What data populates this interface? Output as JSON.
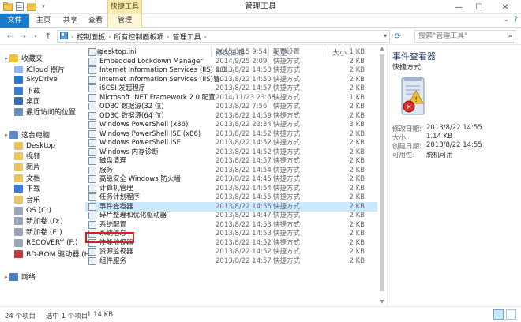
{
  "window": {
    "title": "管理工具",
    "context_tab_label": "快捷工具",
    "buttons": [
      "—",
      "☐",
      "✕"
    ]
  },
  "ribbon": {
    "tabs": [
      "文件",
      "主页",
      "共享",
      "查看",
      "管理"
    ],
    "right_icons": [
      "⌄",
      "?"
    ]
  },
  "address": {
    "path": [
      "控制面板",
      "所有控制面板项",
      "管理工具"
    ],
    "search_placeholder": "搜索\"管理工具\""
  },
  "nav": {
    "items": [
      {
        "label": "收藏夹",
        "level": 0,
        "icon": "star-icon",
        "color": "#f2c12e"
      },
      {
        "label": "iCloud 照片",
        "level": 1,
        "icon": "cloud-icon",
        "color": "#8fb8e8"
      },
      {
        "label": "SkyDrive",
        "level": 1,
        "icon": "skydrive-icon",
        "color": "#2a79c9"
      },
      {
        "label": "下载",
        "level": 1,
        "icon": "download-folder-icon",
        "color": "#3a7bd5"
      },
      {
        "label": "桌面",
        "level": 1,
        "icon": "desktop-folder-icon",
        "color": "#3f6fb3"
      },
      {
        "label": "最近访问的位置",
        "level": 1,
        "icon": "recent-places-icon",
        "color": "#6b8fbd"
      },
      {
        "label": "这台电脑",
        "level": 0,
        "icon": "computer-icon",
        "color": "#5d8ac7"
      },
      {
        "label": "Desktop",
        "level": 1,
        "icon": "folder-icon",
        "color": "#e8c462"
      },
      {
        "label": "视频",
        "level": 1,
        "icon": "videos-folder-icon",
        "color": "#e8c462"
      },
      {
        "label": "图片",
        "level": 1,
        "icon": "pictures-folder-icon",
        "color": "#e8c462"
      },
      {
        "label": "文档",
        "level": 1,
        "icon": "documents-folder-icon",
        "color": "#e8c462"
      },
      {
        "label": "下载",
        "level": 1,
        "icon": "downloads-folder-icon",
        "color": "#3a7bd5"
      },
      {
        "label": "音乐",
        "level": 1,
        "icon": "music-folder-icon",
        "color": "#e8c462"
      },
      {
        "label": "OS (C:)",
        "level": 1,
        "icon": "drive-c-icon",
        "color": "#9aa6b4"
      },
      {
        "label": "新加卷 (D:)",
        "level": 1,
        "icon": "drive-icon",
        "color": "#9aa6b4"
      },
      {
        "label": "新加卷 (E:)",
        "level": 1,
        "icon": "drive-icon",
        "color": "#9aa6b4"
      },
      {
        "label": "RECOVERY (F:)",
        "level": 1,
        "icon": "drive-icon",
        "color": "#9aa6b4"
      },
      {
        "label": "BD-ROM 驱动器 (H",
        "level": 1,
        "icon": "bd-rom-icon",
        "color": "#c43b3b"
      },
      {
        "label": "网络",
        "level": 0,
        "icon": "network-icon",
        "color": "#4a7fc1"
      }
    ]
  },
  "columns": {
    "name": "名称",
    "date": "修改日期",
    "type": "类型",
    "size": "大小"
  },
  "files": [
    {
      "name": "desktop.ini",
      "date": "2015/3/15 9:54",
      "type": "配置设置",
      "size": "1 KB"
    },
    {
      "name": "Embedded Lockdown Manager",
      "date": "2014/9/25 2:09",
      "type": "快捷方式",
      "size": "2 KB"
    },
    {
      "name": "Internet Information Services (IIS) 6.0...",
      "date": "2013/8/22 14:50",
      "type": "快捷方式",
      "size": "2 KB"
    },
    {
      "name": "Internet Information Services (IIS)管...",
      "date": "2013/8/22 14:50",
      "type": "快捷方式",
      "size": "2 KB"
    },
    {
      "name": "iSCSI 发起程序",
      "date": "2013/8/22 14:57",
      "type": "快捷方式",
      "size": "2 KB"
    },
    {
      "name": "Microsoft .NET Framework 2.0 配置",
      "date": "2014/11/23 23:58",
      "type": "快捷方式",
      "size": "1 KB"
    },
    {
      "name": "ODBC 数据源(32 位)",
      "date": "2013/8/22 7:56",
      "type": "快捷方式",
      "size": "2 KB"
    },
    {
      "name": "ODBC 数据源(64 位)",
      "date": "2013/8/22 14:59",
      "type": "快捷方式",
      "size": "2 KB"
    },
    {
      "name": "Windows PowerShell (x86)",
      "date": "2013/8/22 23:34",
      "type": "快捷方式",
      "size": "3 KB"
    },
    {
      "name": "Windows PowerShell ISE (x86)",
      "date": "2013/8/22 14:52",
      "type": "快捷方式",
      "size": "2 KB"
    },
    {
      "name": "Windows PowerShell ISE",
      "date": "2013/8/22 14:52",
      "type": "快捷方式",
      "size": "2 KB"
    },
    {
      "name": "Windows 内存诊断",
      "date": "2013/8/22 14:52",
      "type": "快捷方式",
      "size": "2 KB"
    },
    {
      "name": "磁盘清理",
      "date": "2013/8/22 14:57",
      "type": "快捷方式",
      "size": "2 KB"
    },
    {
      "name": "服务",
      "date": "2013/8/22 14:54",
      "type": "快捷方式",
      "size": "2 KB"
    },
    {
      "name": "高级安全 Windows 防火墙",
      "date": "2013/8/22 14:45",
      "type": "快捷方式",
      "size": "2 KB"
    },
    {
      "name": "计算机管理",
      "date": "2013/8/22 14:54",
      "type": "快捷方式",
      "size": "2 KB"
    },
    {
      "name": "任务计划程序",
      "date": "2013/8/22 14:55",
      "type": "快捷方式",
      "size": "2 KB"
    },
    {
      "name": "事件查看器",
      "date": "2013/8/22 14:55",
      "type": "快捷方式",
      "size": "2 KB",
      "selected": true
    },
    {
      "name": "碎片整理和优化驱动器",
      "date": "2013/8/22 14:47",
      "type": "快捷方式",
      "size": "2 KB"
    },
    {
      "name": "系统配置",
      "date": "2013/8/22 14:53",
      "type": "快捷方式",
      "size": "2 KB"
    },
    {
      "name": "系统信息",
      "date": "2013/8/22 14:53",
      "type": "快捷方式",
      "size": "2 KB"
    },
    {
      "name": "性能监视器",
      "date": "2013/8/22 14:52",
      "type": "快捷方式",
      "size": "2 KB"
    },
    {
      "name": "资源监视器",
      "date": "2013/8/22 14:52",
      "type": "快捷方式",
      "size": "2 KB"
    },
    {
      "name": "组件服务",
      "date": "2013/8/22 14:57",
      "type": "快捷方式",
      "size": "2 KB"
    }
  ],
  "details": {
    "title": "事件查看器",
    "subtitle": "快捷方式",
    "icon": "event-viewer-icon",
    "meta": [
      {
        "label": "修改日期:",
        "value": "2013/8/22 14:55"
      },
      {
        "label": "大小:",
        "value": "1.14 KB"
      },
      {
        "label": "创建日期:",
        "value": "2013/8/22 14:55"
      },
      {
        "label": "可用性:",
        "value": "脱机可用"
      }
    ]
  },
  "status": {
    "count": "24 个项目",
    "selected": "选中 1 个项目",
    "size": "1.14 KB"
  }
}
